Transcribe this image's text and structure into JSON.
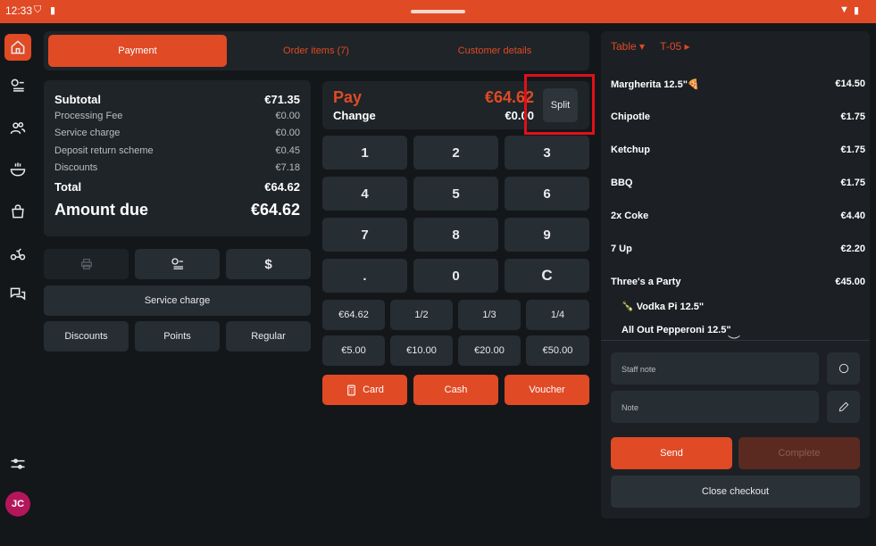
{
  "status": {
    "time": "12:33"
  },
  "tabs": [
    {
      "label": "Payment"
    },
    {
      "label": "Order items (7)"
    },
    {
      "label": "Customer details"
    }
  ],
  "summary": {
    "subtotal_label": "Subtotal",
    "subtotal": "€71.35",
    "processing_label": "Processing Fee",
    "processing": "€0.00",
    "service_label": "Service charge",
    "service": "€0.00",
    "deposit_label": "Deposit return scheme",
    "deposit": "€0.45",
    "discounts_label": "Discounts",
    "discounts": "€7.18",
    "total_label": "Total",
    "total": "€64.62",
    "due_label": "Amount due",
    "due": "€64.62"
  },
  "actions": {
    "dollar": "$",
    "service_charge": "Service charge",
    "discounts": "Discounts",
    "points": "Points",
    "regular": "Regular"
  },
  "pay": {
    "pay_label": "Pay",
    "pay_amount": "€64.62",
    "change_label": "Change",
    "change_amount": "€0.00",
    "split": "Split"
  },
  "keypad": [
    "1",
    "2",
    "3",
    "4",
    "5",
    "6",
    "7",
    "8",
    "9",
    ".",
    "0",
    "C"
  ],
  "quick": [
    "€64.62",
    "1/2",
    "1/3",
    "1/4",
    "€5.00",
    "€10.00",
    "€20.00",
    "€50.00"
  ],
  "methods": {
    "card": "Card",
    "cash": "Cash",
    "voucher": "Voucher"
  },
  "order": {
    "table_label": "Table ▾",
    "table_value": "T-05 ▸",
    "items": [
      {
        "name": "Margherita 12.5\"🍕",
        "price": "€14.50"
      },
      {
        "name": "Chipotle",
        "price": "€1.75"
      },
      {
        "name": "Ketchup",
        "price": "€1.75"
      },
      {
        "name": "BBQ",
        "price": "€1.75"
      },
      {
        "name": "2x Coke",
        "price": "€4.40"
      },
      {
        "name": "7 Up",
        "price": "€2.20"
      },
      {
        "name": "Three's a Party",
        "price": "€45.00"
      }
    ],
    "subitems": [
      "🍾 Vodka Pi 12.5\"",
      "All Out Pepperoni 12.5\""
    ],
    "staff_note": "Staff note",
    "note": "Note",
    "send": "Send",
    "complete": "Complete",
    "close": "Close checkout"
  },
  "user": {
    "initials": "JC"
  }
}
